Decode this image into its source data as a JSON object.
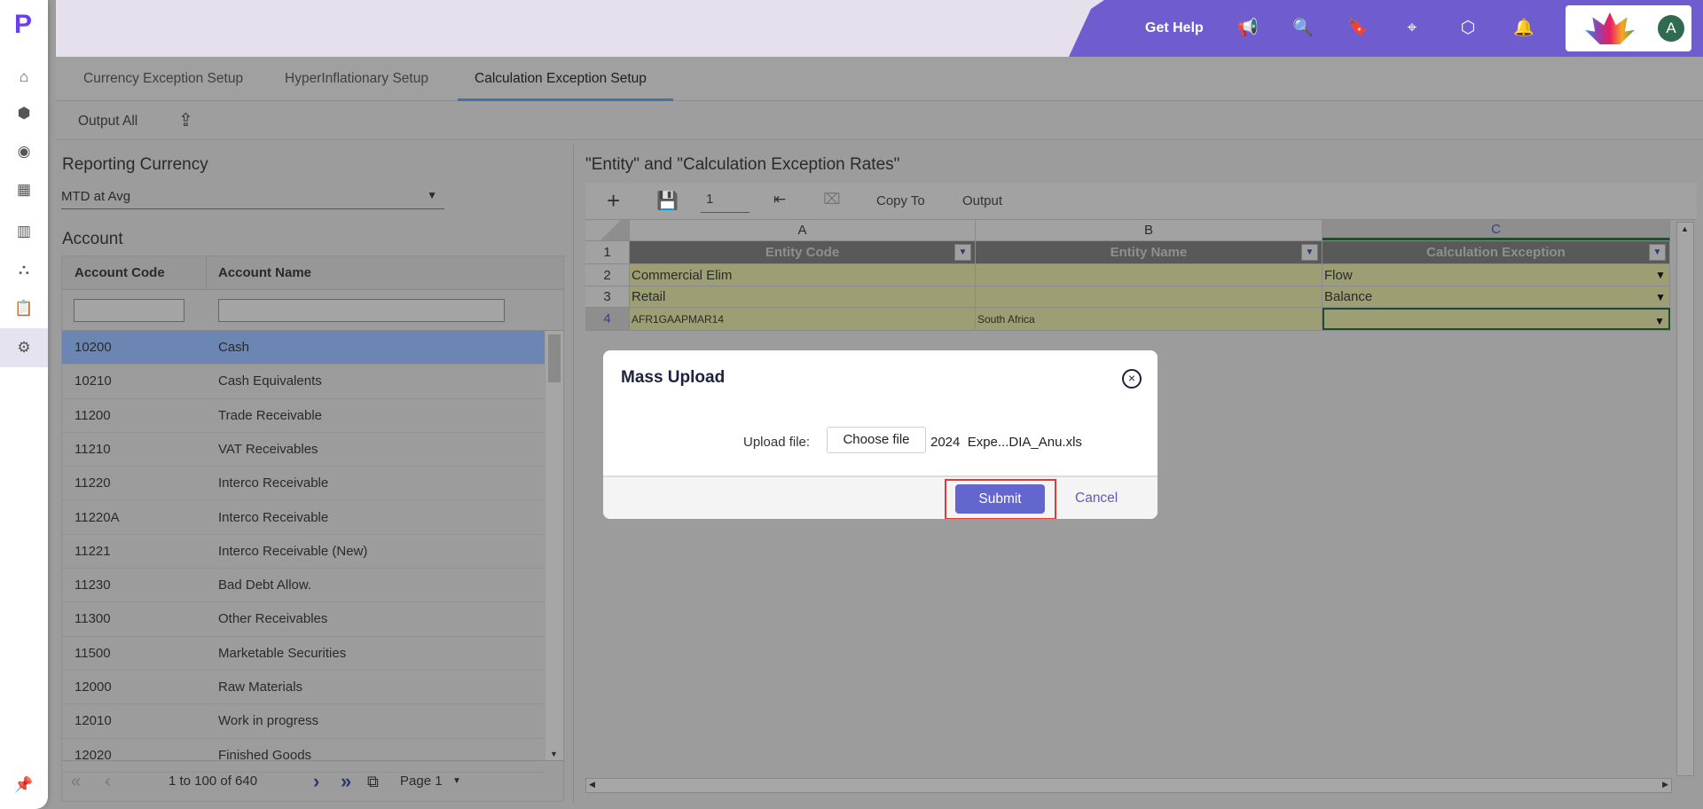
{
  "sidebar": {
    "icons": [
      "home-icon",
      "cube-icon",
      "target-icon",
      "grid-icon",
      "report-icon",
      "hierarchy-icon",
      "clipboard-icon",
      "gear-icon"
    ],
    "pin": "pin-icon"
  },
  "header": {
    "get_help": "Get Help",
    "avatar_letter": "A",
    "purple": "#6f5ccf"
  },
  "tabs": [
    {
      "label": "Currency Exception Setup"
    },
    {
      "label": "HyperInflationary Setup"
    },
    {
      "label": "Calculation Exception Setup",
      "active": true
    }
  ],
  "toolbar": {
    "output_all": "Output All"
  },
  "left": {
    "reporting_currency_label": "Reporting Currency",
    "reporting_currency_value": "MTD at Avg",
    "account_label": "Account",
    "columns": [
      "Account Code",
      "Account Name"
    ],
    "rows": [
      [
        "10200",
        "Cash"
      ],
      [
        "10210",
        "Cash Equivalents"
      ],
      [
        "11200",
        "Trade Receivable"
      ],
      [
        "11210",
        "VAT Receivables"
      ],
      [
        "11220",
        "Interco Receivable"
      ],
      [
        "11220A",
        "Interco Receivable"
      ],
      [
        "11221",
        "Interco Receivable (New)"
      ],
      [
        "11230",
        "Bad Debt Allow."
      ],
      [
        "11300",
        "Other Receivables"
      ],
      [
        "11500",
        "Marketable Securities"
      ],
      [
        "12000",
        "Raw Materials"
      ],
      [
        "12010",
        "Work in progress"
      ],
      [
        "12020",
        "Finished Goods"
      ]
    ],
    "selected_index": 0,
    "pager": {
      "range": "1 to 100 of 640",
      "page": "Page 1"
    }
  },
  "right": {
    "title": "\"Entity\" and \"Calculation Exception Rates\"",
    "page_input": "1",
    "copy_to": "Copy To",
    "output": "Output",
    "col_letters": [
      "A",
      "B",
      "C"
    ],
    "row_numbers": [
      "1",
      "2",
      "3",
      "4"
    ],
    "headers": [
      "Entity Code",
      "Entity Name",
      "Calculation Exception"
    ],
    "rows": [
      [
        "Commercial Elim",
        "",
        "Flow"
      ],
      [
        "Retail",
        "",
        "Balance"
      ],
      [
        "AFR1GAAPMAR14",
        "South Africa",
        ""
      ]
    ]
  },
  "modal": {
    "title": "Mass Upload",
    "upload_label": "Upload file:",
    "choose_file": "Choose file",
    "file_name": "2024  Expe...DIA_Anu.xls",
    "submit": "Submit",
    "cancel": "Cancel",
    "accent": "#6466d0",
    "highlight": "#e53935"
  }
}
